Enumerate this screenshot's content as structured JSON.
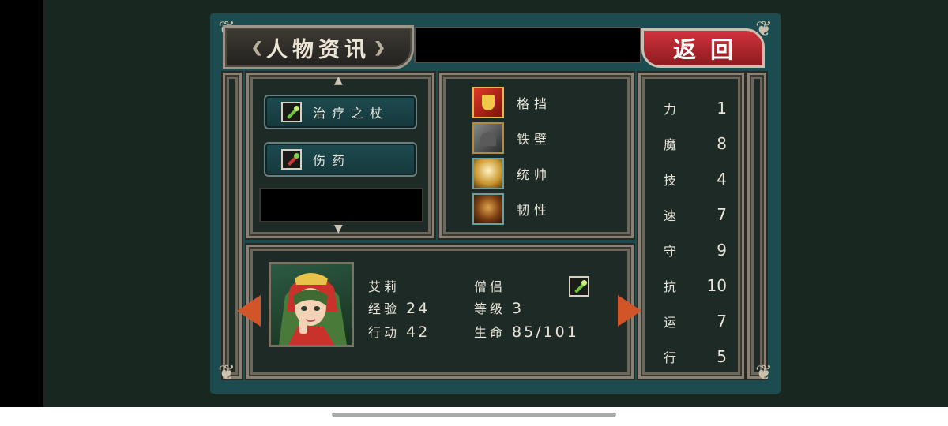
{
  "title": "人物资讯",
  "back_label": "返回",
  "colors": {
    "panel": "#1c4c4f",
    "frame": "#8a8175",
    "back_button": "#c02a31",
    "text": "#e8e4da",
    "rarity_border": "#b58c3e"
  },
  "items": [
    {
      "name": "治疗之杖",
      "icon": "staff-icon"
    },
    {
      "name": "伤药",
      "icon": "potion-icon"
    }
  ],
  "skills": [
    {
      "name": "格挡",
      "icon": "block-shield-icon"
    },
    {
      "name": "铁壁",
      "icon": "iron-wall-icon"
    },
    {
      "name": "统帅",
      "icon": "command-icon"
    },
    {
      "name": "韧性",
      "icon": "tenacity-icon"
    }
  ],
  "stats": [
    {
      "name": "力",
      "value": "1"
    },
    {
      "name": "魔",
      "value": "8"
    },
    {
      "name": "技",
      "value": "4"
    },
    {
      "name": "速",
      "value": "7"
    },
    {
      "name": "守",
      "value": "9"
    },
    {
      "name": "抗",
      "value": "10"
    },
    {
      "name": "运",
      "value": "7"
    },
    {
      "name": "行",
      "value": "5"
    }
  ],
  "character": {
    "name": "艾莉",
    "class": "僧侣",
    "exp_label": "经验",
    "exp": "24",
    "level_label": "等级",
    "level": "3",
    "move_label": "行动",
    "move": "42",
    "hp_label": "生命",
    "hp": "85/101",
    "weapon_icon": "staff-icon"
  }
}
